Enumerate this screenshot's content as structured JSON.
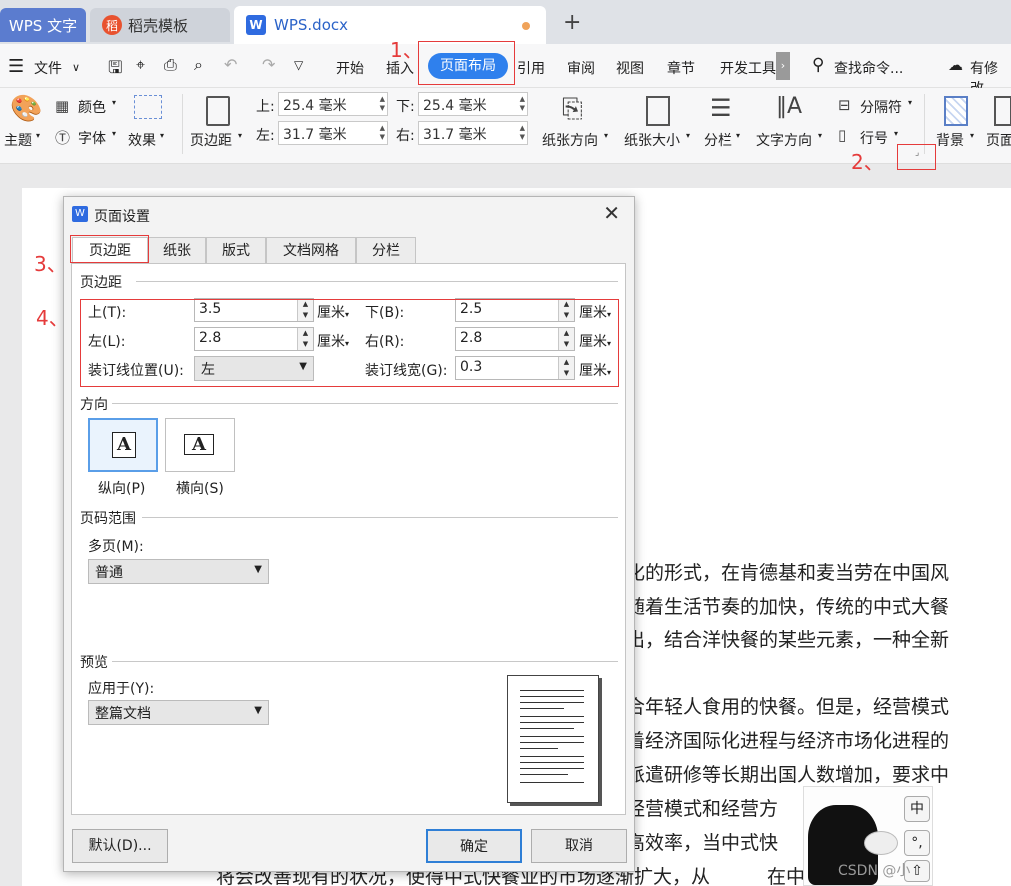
{
  "tabs": {
    "wps": "WPS 文字",
    "daoke": "稻壳模板",
    "doc": "WPS.docx",
    "plus": "+"
  },
  "menu": {
    "file": "文件",
    "items": [
      "开始",
      "插入",
      "页面布局",
      "引用",
      "审阅",
      "视图",
      "章节",
      "开发工具"
    ],
    "search": "查找命令...",
    "modify": "有修改"
  },
  "ribbon": {
    "theme": "主题",
    "color": "颜色",
    "font": "字体",
    "effect": "效果",
    "margins": "页边距",
    "top_label": "上:",
    "top_value": "25.4 毫米",
    "bottom_label": "下:",
    "bottom_value": "25.4 毫米",
    "left_label": "左:",
    "left_value": "31.7 毫米",
    "right_label": "右:",
    "right_value": "31.7 毫米",
    "orientation": "纸张方向",
    "size": "纸张大小",
    "columns": "分栏",
    "text_direction": "文字方向",
    "separator": "分隔符",
    "line_number": "行号",
    "background": "背景",
    "page": "页面"
  },
  "annotations": [
    "1、",
    "2、",
    "3、",
    "4、"
  ],
  "dialog": {
    "title": "页面设置",
    "tabs": [
      "页边距",
      "纸张",
      "版式",
      "文档网格",
      "分栏"
    ],
    "margins_section": "页边距",
    "top_label": "上(T):",
    "top_value": "3.5",
    "bottom_label": "下(B):",
    "bottom_value": "2.5",
    "left_label": "左(L):",
    "left_value": "2.8",
    "right_label": "右(R):",
    "right_value": "2.8",
    "gutter_pos_label": "装订线位置(U):",
    "gutter_pos_value": "左",
    "gutter_width_label": "装订线宽(G):",
    "gutter_width_value": "0.3",
    "unit": "厘米",
    "orientation_section": "方向",
    "portrait": "纵向(P)",
    "landscape": "横向(S)",
    "page_range_section": "页码范围",
    "multi_page_label": "多页(M):",
    "multi_page_value": "普通",
    "preview_section": "预览",
    "apply_to_label": "应用于(Y):",
    "apply_to_value": "整篇文档",
    "default_button": "默认(D)...",
    "ok_button": "确定",
    "cancel_button": "取消"
  },
  "document": {
    "lines": [
      "化的形式，在肯德基和麦当劳在中国风",
      "随着生活节奏的加快，传统的中式大餐",
      "出，结合洋快餐的某些元素，一种全新",
      "合年轻人食用的快餐。但是，经营模式",
      "着经济国际化进程与经济市场化进程的",
      "派遣研修等长期出国人数增加，要求中",
      "经营模式和经营方　　　　这一现状",
      "高效率，当中式快　　　　缺点之后",
      "将会改善现有的状况，使得中式快餐业的市场逐渐扩大，从　　　在中国的"
    ]
  },
  "ime": "中",
  "watermark": "CSDN @小"
}
